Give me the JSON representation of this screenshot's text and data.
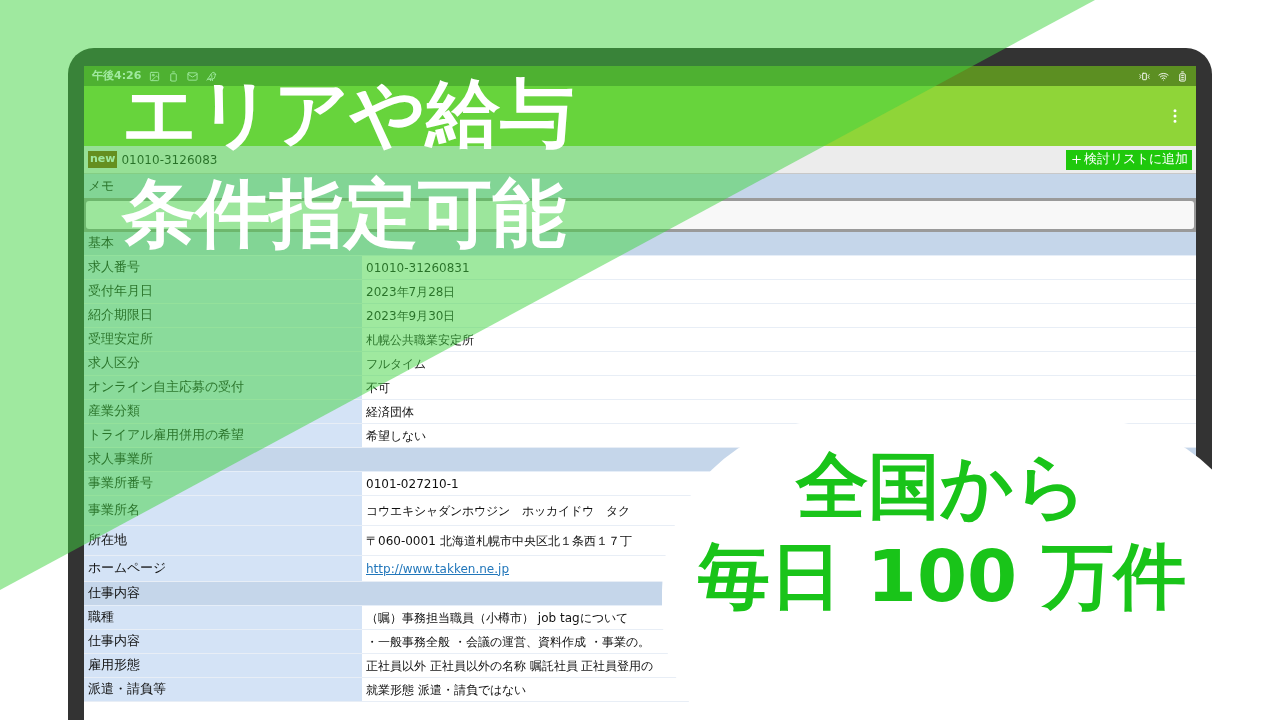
{
  "status_bar": {
    "time": "午後4:26"
  },
  "header": {
    "badge": "new",
    "job_number": "01010-3126083",
    "add_button": "検討リストに追加"
  },
  "memo": {
    "label": "メモ"
  },
  "rows": [
    {
      "kind": "section",
      "label": "基本"
    },
    {
      "kind": "row",
      "label": "求人番号",
      "value": "01010-31260831"
    },
    {
      "kind": "row",
      "label": "受付年月日",
      "value": "2023年7月28日"
    },
    {
      "kind": "row",
      "label": "紹介期限日",
      "value": "2023年9月30日"
    },
    {
      "kind": "row",
      "label": "受理安定所",
      "value": "札幌公共職業安定所"
    },
    {
      "kind": "row",
      "label": "求人区分",
      "value": "フルタイム"
    },
    {
      "kind": "row",
      "label": "オンライン自主応募の受付",
      "value": "不可"
    },
    {
      "kind": "row",
      "label": "産業分類",
      "value": "経済団体"
    },
    {
      "kind": "row",
      "label": "トライアル雇用併用の希望",
      "value": "希望しない"
    },
    {
      "kind": "section",
      "label": "求人事業所"
    },
    {
      "kind": "row",
      "label": "事業所番号",
      "value": "0101-027210-1"
    },
    {
      "kind": "tall",
      "label": "事業所名",
      "value": "コウエキシャダンホウジン　ホッカイドウ　タク"
    },
    {
      "kind": "tall",
      "label": "所在地",
      "value": "〒060-0001 北海道札幌市中央区北１条西１７丁"
    },
    {
      "kind": "link",
      "label": "ホームページ",
      "value": "http://www.takken.ne.jp"
    },
    {
      "kind": "section",
      "label": "仕事内容"
    },
    {
      "kind": "row",
      "label": "職種",
      "value": "（嘱）事務担当職員（小樽市） job tagについて"
    },
    {
      "kind": "row",
      "label": "仕事内容",
      "value": "・一般事務全般 ・会議の運営、資料作成 ・事業の。"
    },
    {
      "kind": "row",
      "label": "雇用形態",
      "value": "正社員以外 正社員以外の名称 嘱託社員 正社員登用の"
    },
    {
      "kind": "row",
      "label": "派遣・請負等",
      "value": "就業形態 派遣・請負ではない"
    }
  ],
  "promo": {
    "headline": [
      "エリアや給与",
      "条件指定可能"
    ],
    "callout": [
      "全国から",
      "毎日 100 万件"
    ]
  }
}
